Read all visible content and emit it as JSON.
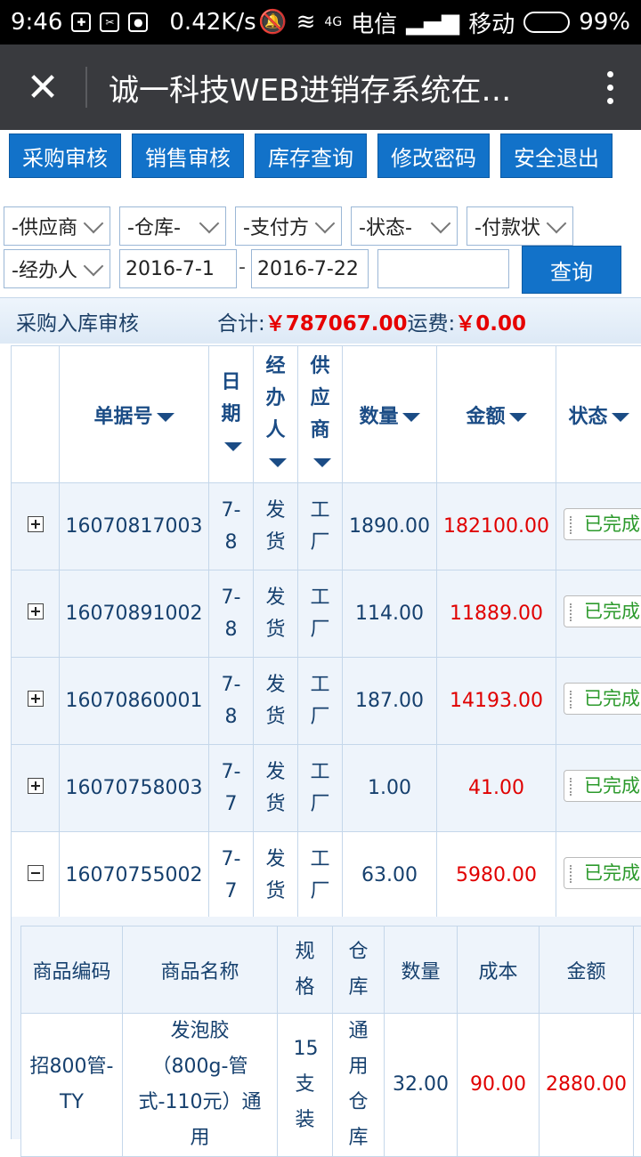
{
  "statusbar": {
    "time": "9:46",
    "speed": "0.42K/s",
    "carrier1": "电信",
    "carrier2": "移动",
    "battery": "99%",
    "net_label": "4G"
  },
  "titlebar": {
    "title": "诚一科技WEB进销存系统在…",
    "close_icon": "close-icon",
    "more_icon": "more-vertical-icon"
  },
  "nav": {
    "buttons": [
      "采购审核",
      "销售审核",
      "库存查询",
      "修改密码",
      "安全退出"
    ]
  },
  "filters": {
    "supplier": "-供应商",
    "warehouse": "-仓库-",
    "payment_method": "-支付方",
    "status": "-状态-",
    "payment_status": "-付款状",
    "handler": "-经办人",
    "date_from": "2016-7-1",
    "date_sep": "-",
    "date_to": "2016-7-22",
    "keyword": "",
    "query_label": "查询"
  },
  "panel": {
    "title": "采购入库审核",
    "total_label": "合计:",
    "total_value": "￥787067.00",
    "freight_label": "运费:",
    "freight_value": "￥0.00"
  },
  "grid": {
    "headers": [
      "单据号",
      "日期",
      "经办人",
      "供应商",
      "数量",
      "金额",
      "状态"
    ],
    "rows": [
      {
        "id": "16070817003",
        "date": "7-8",
        "handler": "发货",
        "supplier": "工厂",
        "qty": "1890.00",
        "amount": "182100.00",
        "status": "已完成",
        "expanded": false
      },
      {
        "id": "16070891002",
        "date": "7-8",
        "handler": "发货",
        "supplier": "工厂",
        "qty": "114.00",
        "amount": "11889.00",
        "status": "已完成",
        "expanded": false
      },
      {
        "id": "16070860001",
        "date": "7-8",
        "handler": "发货",
        "supplier": "工厂",
        "qty": "187.00",
        "amount": "14193.00",
        "status": "已完成",
        "expanded": false
      },
      {
        "id": "16070758003",
        "date": "7-7",
        "handler": "发货",
        "supplier": "工厂",
        "qty": "1.00",
        "amount": "41.00",
        "status": "已完成",
        "expanded": false
      },
      {
        "id": "16070755002",
        "date": "7-7",
        "handler": "发货",
        "supplier": "工厂",
        "qty": "63.00",
        "amount": "5980.00",
        "status": "已完成",
        "expanded": true
      }
    ]
  },
  "detail": {
    "headers": [
      "商品编码",
      "商品名称",
      "规格",
      "仓库",
      "数量",
      "成本",
      "金额"
    ],
    "row": {
      "code": "招800管-TY",
      "name": "发泡胶（800g-管式-110元）通用",
      "spec": "15支装",
      "warehouse": "通用仓库",
      "qty": "32.00",
      "cost": "90.00",
      "amount": "2880.00"
    }
  },
  "colors": {
    "nav_button": "#1272c9",
    "titlebar": "#393a3e",
    "amount_red": "#e00000",
    "status_green": "#2c9a2c"
  }
}
